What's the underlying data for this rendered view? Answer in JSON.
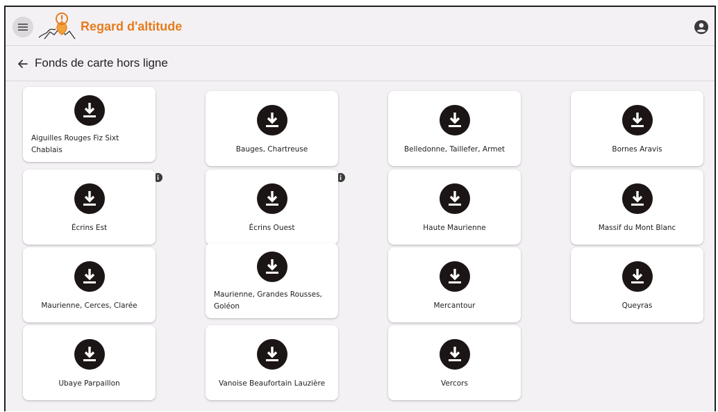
{
  "app": {
    "title": "Regard d'altitude",
    "accent_color": "#e77b1d",
    "menu_icon": "hamburger-menu-icon",
    "account_icon": "account-circle-icon"
  },
  "page": {
    "title": "Fonds de carte hors ligne",
    "back_icon": "arrow-back-icon"
  },
  "maps": [
    {
      "label": "Aiguilles Rouges Fiz Sixt Chablais",
      "icon": "download-icon"
    },
    {
      "label": "Bauges, Chartreuse",
      "icon": "download-icon"
    },
    {
      "label": "Belledonne, Taillefer, Armet",
      "icon": "download-icon"
    },
    {
      "label": "Bornes Aravis",
      "icon": "download-icon"
    },
    {
      "label": "Écrins Est",
      "icon": "download-icon",
      "info": true
    },
    {
      "label": "Écrins Ouest",
      "icon": "download-icon",
      "info": true
    },
    {
      "label": "Haute Maurienne",
      "icon": "download-icon"
    },
    {
      "label": "Massif du Mont Blanc",
      "icon": "download-icon"
    },
    {
      "label": "Maurienne, Cerces, Clarée",
      "icon": "download-icon"
    },
    {
      "label": "Maurienne, Grandes Rousses, Goléon",
      "icon": "download-icon"
    },
    {
      "label": "Mercantour",
      "icon": "download-icon"
    },
    {
      "label": "Queyras",
      "icon": "download-icon"
    },
    {
      "label": "Ubaye Parpaillon",
      "icon": "download-icon"
    },
    {
      "label": "Vanoise Beaufortain Lauzière",
      "icon": "download-icon"
    },
    {
      "label": "Vercors",
      "icon": "download-icon"
    }
  ]
}
